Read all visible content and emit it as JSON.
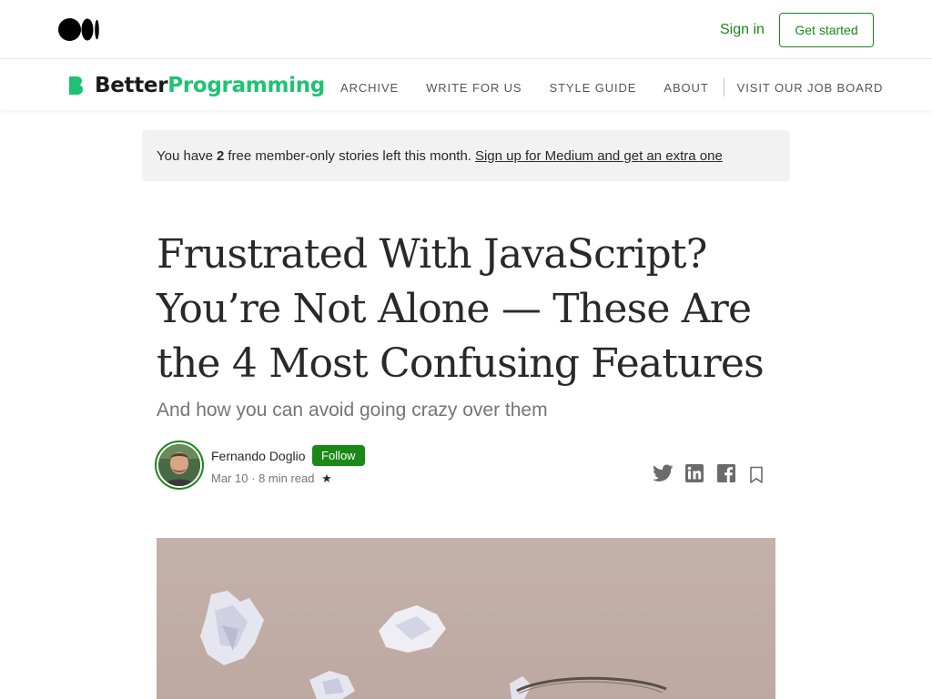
{
  "topbar": {
    "sign_in": "Sign in",
    "get_started": "Get started"
  },
  "publication": {
    "name_part1": "Better",
    "name_part2": "Programming",
    "nav": [
      "ARCHIVE",
      "WRITE FOR US",
      "STYLE GUIDE",
      "ABOUT",
      "VISIT OUR JOB BOARD"
    ]
  },
  "banner": {
    "prefix": "You have",
    "count": "2",
    "suffix": "free member-only stories left this month.",
    "link": "Sign up for Medium and get an extra one"
  },
  "article": {
    "title": "Frustrated With JavaScript? You’re Not Alone — These Are the 4 Most Confusing Features",
    "subtitle": "And how you can avoid going crazy over them",
    "author": "Fernando Doglio",
    "follow_label": "Follow",
    "date": "Mar 10",
    "separator": "·",
    "read_time": "8 min read",
    "star": "★"
  },
  "share_icons": [
    "twitter-icon",
    "linkedin-icon",
    "facebook-icon",
    "bookmark-icon"
  ],
  "colors": {
    "accent_green": "#1a8917",
    "publication_green": "#1fc272",
    "banner_bg": "#f2f2f2"
  }
}
